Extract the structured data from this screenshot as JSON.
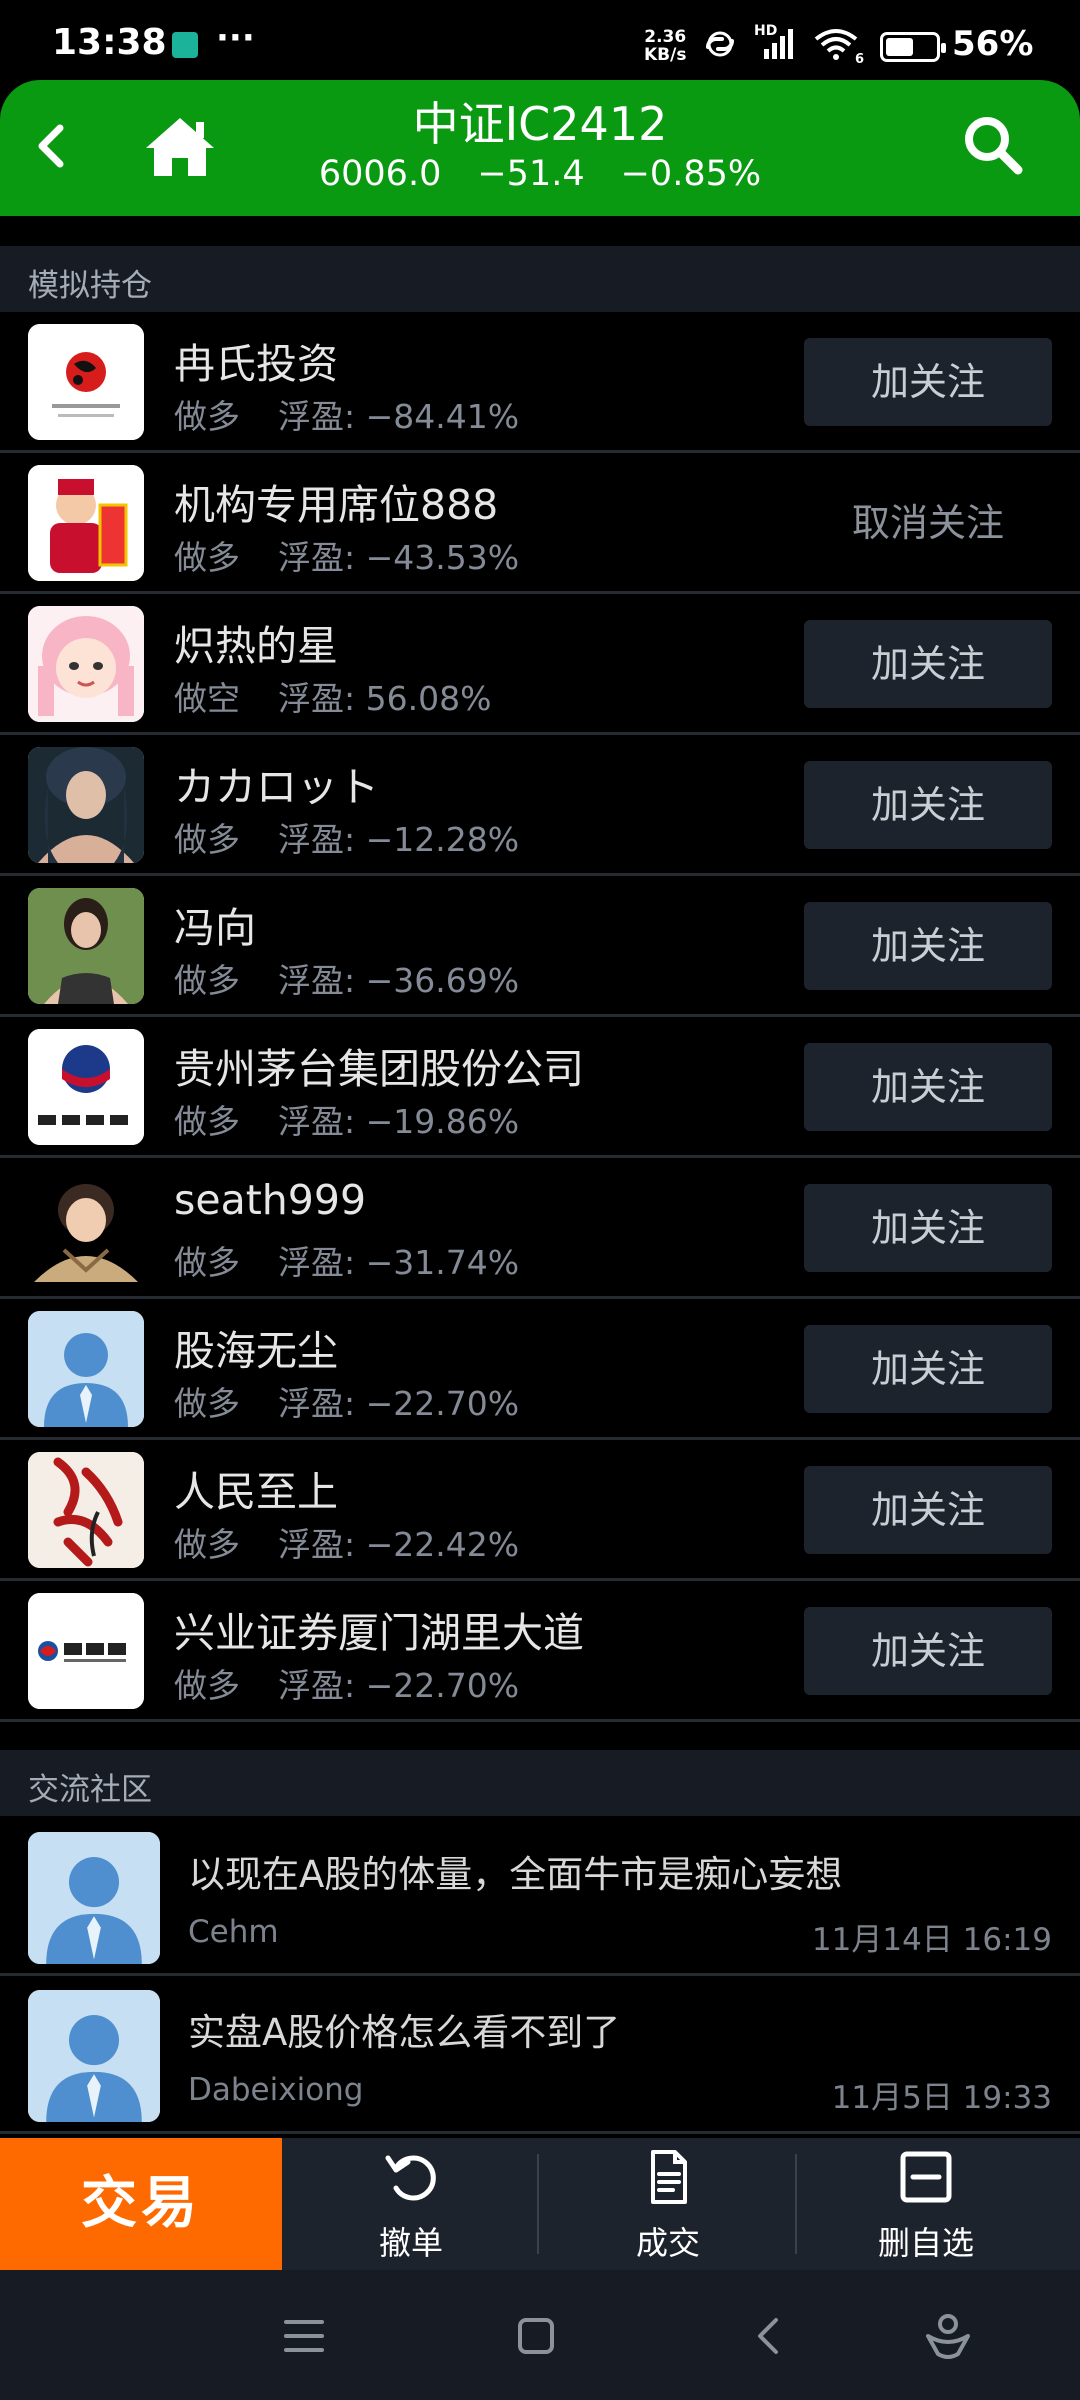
{
  "status_bar": {
    "time": "13:38",
    "dots": "···",
    "net_speed_value": "2.36",
    "net_speed_unit": "KB/s",
    "hd": "HD",
    "wifi_badge": "6",
    "battery": "56%",
    "battery_level": 0.56
  },
  "header": {
    "title": "中证IC2412",
    "price": "6006.0",
    "change": "−51.4",
    "change_pct": "−0.85%",
    "bg_color": "#0a9a12"
  },
  "positions_section": {
    "title": "模拟持仓",
    "items": [
      {
        "name": "冉氏投资",
        "direction": "做多",
        "pnl_label": "浮盈:",
        "pnl": "−84.41%",
        "button": "加关注",
        "followed": false,
        "avatar": "ranshi-logo"
      },
      {
        "name": "机构专用席位888",
        "direction": "做多",
        "pnl_label": "浮盈:",
        "pnl": "−43.53%",
        "button": "取消关注",
        "followed": true,
        "avatar": "caishen-avatar"
      },
      {
        "name": "炽热的星",
        "direction": "做空",
        "pnl_label": "浮盈:",
        "pnl": "56.08%",
        "button": "加关注",
        "followed": false,
        "avatar": "anime-girl-avatar"
      },
      {
        "name": "カカロット",
        "direction": "做多",
        "pnl_label": "浮盈:",
        "pnl": "−12.28%",
        "button": "加关注",
        "followed": false,
        "avatar": "woman-photo-avatar"
      },
      {
        "name": "冯向",
        "direction": "做多",
        "pnl_label": "浮盈:",
        "pnl": "−36.69%",
        "button": "加关注",
        "followed": false,
        "avatar": "woman-photo-avatar"
      },
      {
        "name": "贵州茅台集团股份公司",
        "direction": "做多",
        "pnl_label": "浮盈:",
        "pnl": "−19.86%",
        "button": "加关注",
        "followed": false,
        "avatar": "moutai-logo"
      },
      {
        "name": "seath999",
        "direction": "做多",
        "pnl_label": "浮盈:",
        "pnl": "−31.74%",
        "button": "加关注",
        "followed": false,
        "avatar": "cartoon-man-avatar"
      },
      {
        "name": "股海无尘",
        "direction": "做多",
        "pnl_label": "浮盈:",
        "pnl": "−22.70%",
        "button": "加关注",
        "followed": false,
        "avatar": "default-user-avatar"
      },
      {
        "name": "人民至上",
        "direction": "做多",
        "pnl_label": "浮盈:",
        "pnl": "−22.42%",
        "button": "加关注",
        "followed": false,
        "avatar": "calligraphy-avatar"
      },
      {
        "name": "兴业证券厦门湖里大道",
        "direction": "做多",
        "pnl_label": "浮盈:",
        "pnl": "−22.70%",
        "button": "加关注",
        "followed": false,
        "avatar": "industrial-securities-logo"
      }
    ]
  },
  "community_section": {
    "title": "交流社区",
    "posts": [
      {
        "title": "以现在A股的体量，全面牛市是痴心妄想",
        "user": "Cehm",
        "time": "11月14日 16:19"
      },
      {
        "title": "实盘A股价格怎么看不到了",
        "user": "Dabeixiong",
        "time": "11月5日 19:33"
      }
    ]
  },
  "toolbar": {
    "trade": "交易",
    "trade_color": "#ff6a00",
    "cancel_order": "撤单",
    "deals": "成交",
    "remove_watch": "删自选"
  }
}
